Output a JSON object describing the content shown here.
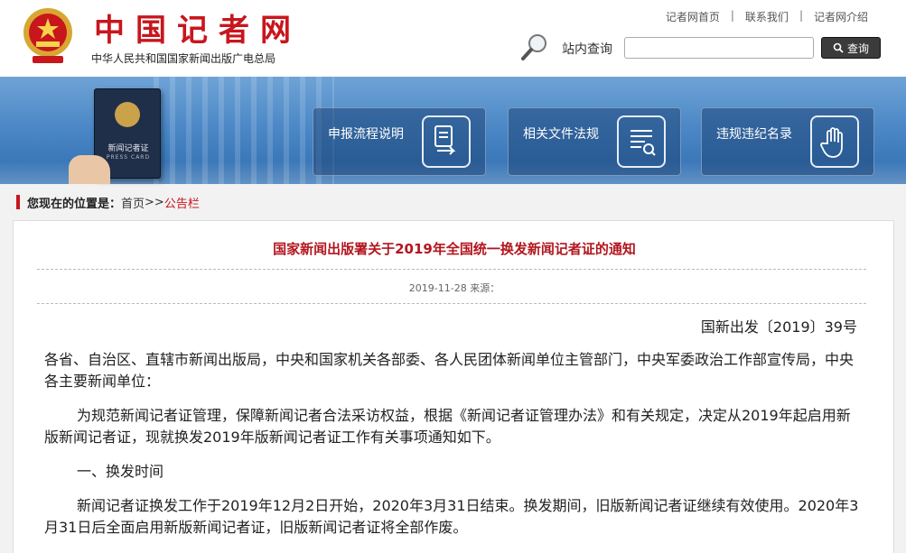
{
  "header": {
    "site_title": "中国记者网",
    "site_subtitle": "中华人民共和国国家新闻出版广电总局",
    "top_links": [
      "记者网首页",
      "联系我们",
      "记者网介绍"
    ],
    "search_label": "站内查询",
    "search_value": "",
    "search_button": "查询"
  },
  "banner": {
    "press_card_title": "新闻记者证",
    "press_card_sub": "PRESS CARD",
    "tiles": [
      {
        "label": "申报流程说明",
        "icon": "document-arrow-icon"
      },
      {
        "label": "相关文件法规",
        "icon": "document-search-icon"
      },
      {
        "label": "违规违纪名录",
        "icon": "stop-hand-icon"
      }
    ]
  },
  "breadcrumb": {
    "lead": "您现在的位置是：",
    "home": "首页",
    "sep": ">>",
    "current": "公告栏"
  },
  "article": {
    "title": "国家新闻出版署关于2019年全国统一换发新闻记者证的通知",
    "meta": "2019-11-28 来源：",
    "doc_no": "国新出发〔2019〕39号",
    "paragraphs": [
      "各省、自治区、直辖市新闻出版局，中央和国家机关各部委、各人民团体新闻单位主管部门，中央军委政治工作部宣传局，中央各主要新闻单位：",
      "为规范新闻记者证管理，保障新闻记者合法采访权益，根据《新闻记者证管理办法》和有关规定，决定从2019年起启用新版新闻记者证，现就换发2019年版新闻记者证工作有关事项通知如下。",
      "一、换发时间",
      "新闻记者证换发工作于2019年12月2日开始，2020年3月31日结束。换发期间，旧版新闻记者证继续有效使用。2020年3月31日后全面启用新版新闻记者证，旧版新闻记者证将全部作废。"
    ]
  },
  "colors": {
    "brand_red": "#c8161d",
    "title_red": "#b3161e",
    "banner_blue": "#4d89c7"
  }
}
